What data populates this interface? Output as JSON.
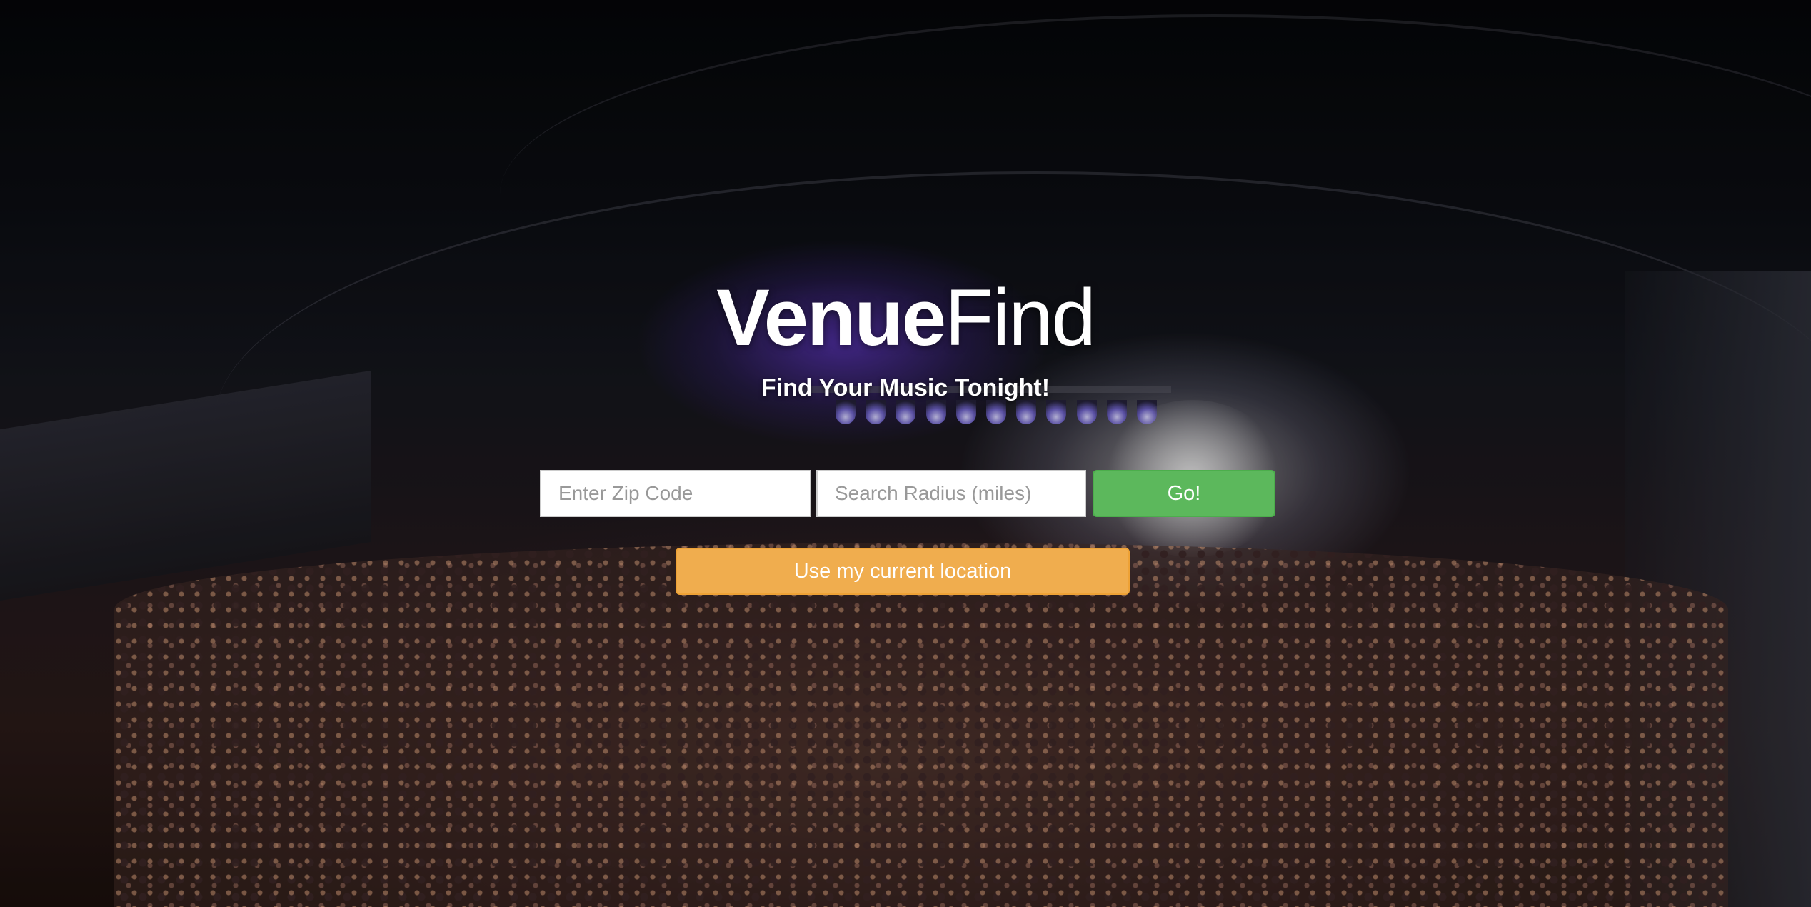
{
  "brand": {
    "name_strong": "Venue",
    "name_light": "Find"
  },
  "tagline": "Find Your Music Tonight!",
  "search": {
    "zip_placeholder": "Enter Zip Code",
    "zip_value": "",
    "radius_placeholder": "Search Radius (miles)",
    "radius_value": "",
    "go_label": "Go!"
  },
  "location_button_label": "Use my current location",
  "colors": {
    "go_button": "#5cb85c",
    "location_button": "#f0ad4e",
    "text": "#ffffff"
  }
}
